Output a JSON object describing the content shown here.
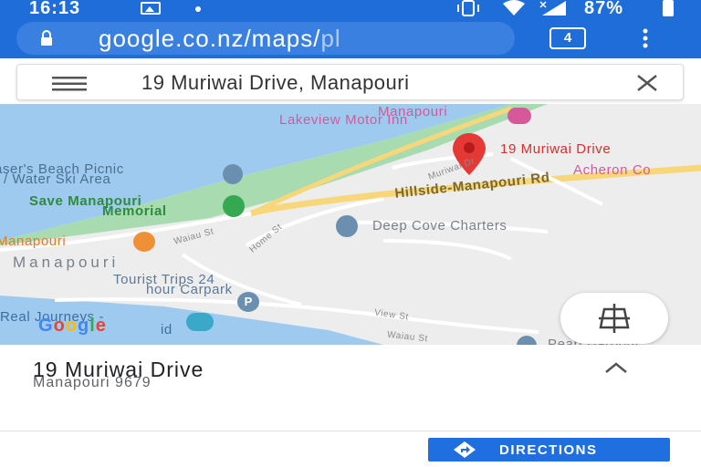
{
  "status_bar": {
    "time": "16:13",
    "battery": "87%",
    "icons": [
      "image-icon",
      "dot-icon",
      "vibrate-icon",
      "wifi-icon",
      "signal-icon",
      "battery-icon"
    ]
  },
  "browser": {
    "url_main": "google.co.nz/maps/",
    "url_tail": "pl",
    "tab_count": "4"
  },
  "search": {
    "value": "19 Muriwai Drive, Manapouri"
  },
  "map": {
    "labels": {
      "motor_inn_1": "Manapouri",
      "motor_inn_2": "Lakeview Motor Inn",
      "pin_label": "19 Muriwai Drive",
      "acheron": "Acheron Co",
      "beach_1": "aser's Beach Picnic",
      "beach_2": "/ Water Ski Area",
      "memorial_1": "Save Manapouri",
      "memorial_2": "Memorial",
      "hillside_rd": "Hillside-Manapouri Rd",
      "muriwai_dr": "Muriwai Dr",
      "deep_cove": "Deep Cove Charters",
      "manapouri_poi": "Manapouri",
      "waiau_st": "Waiau St",
      "home_st": "Home St",
      "town": "Manapouri",
      "tourist_1": "Tourist Trips 24",
      "tourist_2": "hour Carpark",
      "real_journeys": "Real Journeys -",
      "real_journeys_tail": "id",
      "view_st": "View St",
      "waiau_st_2": "Waiau St",
      "pearl_harbour": "Pearl Harbour",
      "google": "Google"
    },
    "colors": {
      "water": "#9fcaf0",
      "park": "#a8dbb0",
      "land": "#ededed",
      "major_road": "#f7d77a",
      "pin": "#e53935"
    }
  },
  "place": {
    "title": "19 Muriwai Drive",
    "subtitle": "Manapouri 9679"
  },
  "actions": {
    "directions": "DIRECTIONS"
  }
}
